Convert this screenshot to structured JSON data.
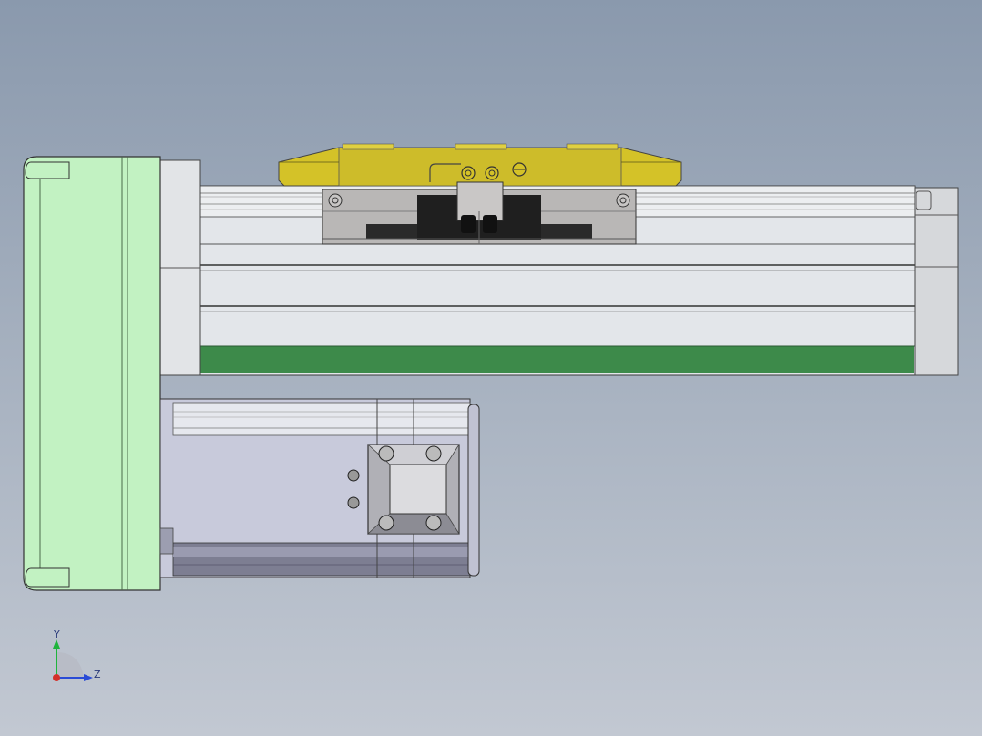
{
  "viewer": {
    "view_name": "Top",
    "model_colors": {
      "motor_end_cap": "#c2f2c2",
      "carriage_plate": "#d4c228",
      "rail_body": "#e2e5e8",
      "rail_stripe": "#3d8a4a",
      "motor_body": "#c7cadb",
      "block": "#b8b6b6"
    }
  },
  "triad": {
    "y_label": "Y",
    "z_label": "Z",
    "y_color": "#1fb43c",
    "z_color": "#2a4bd6",
    "x_color": "#d4302a"
  }
}
